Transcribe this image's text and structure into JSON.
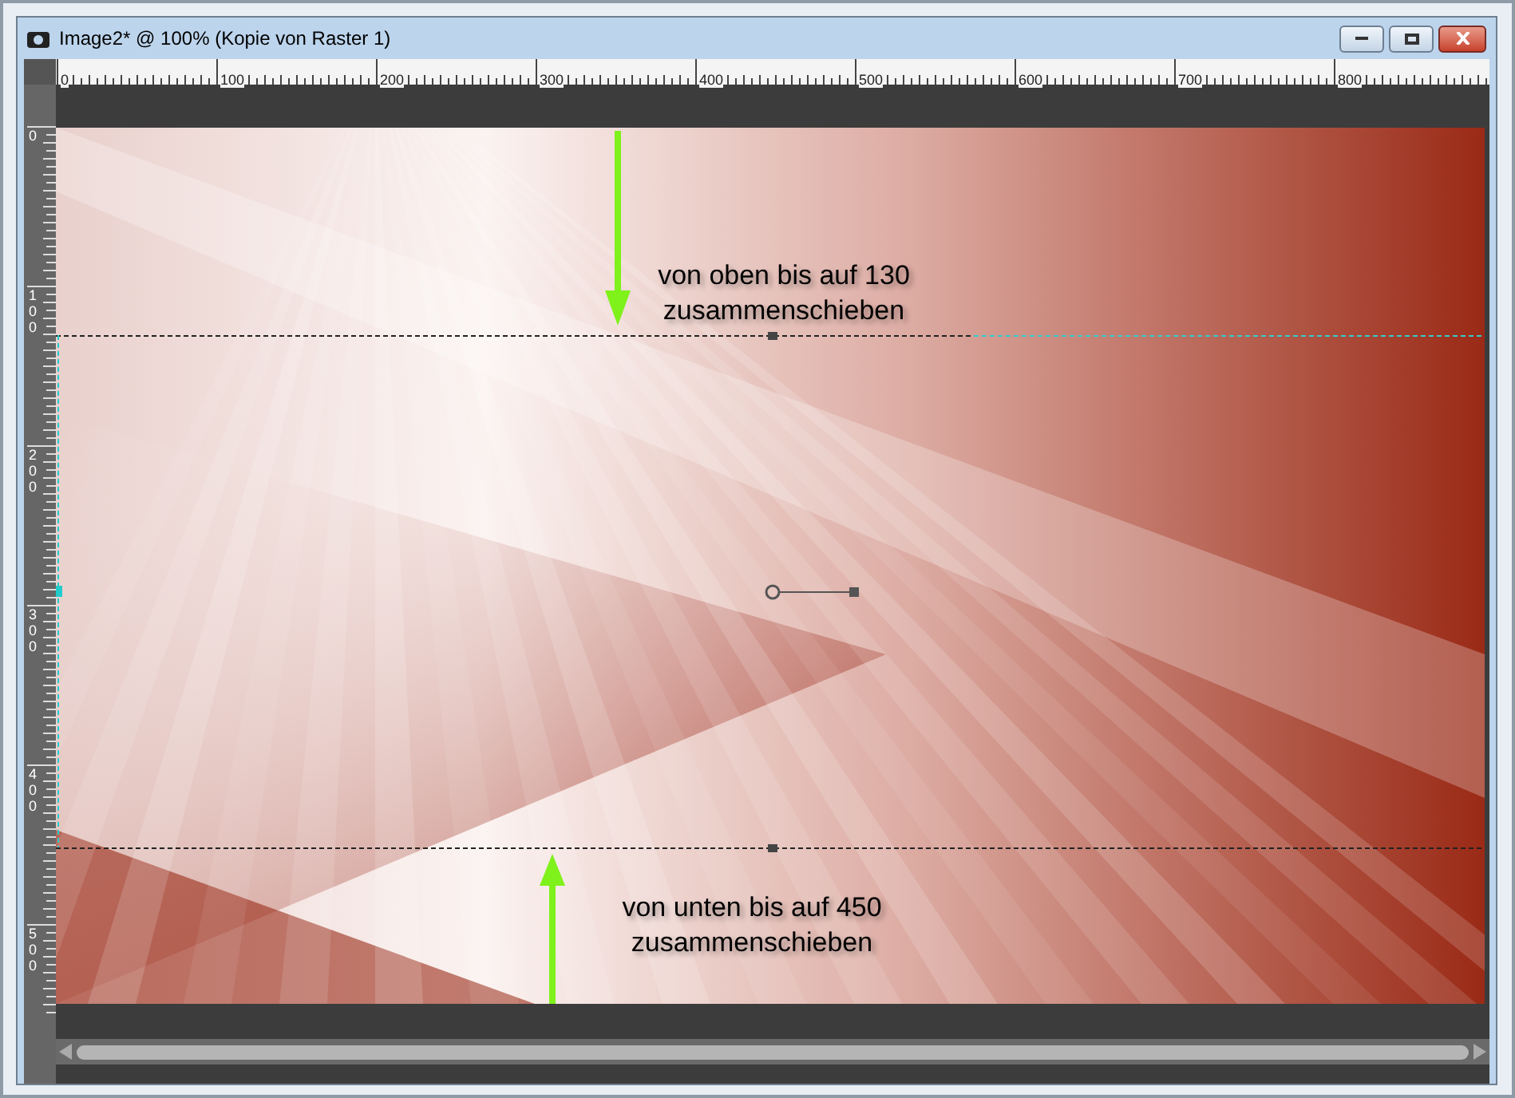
{
  "window": {
    "title": "Image2* @ 100% (Kopie von Raster 1)"
  },
  "ruler_top": {
    "labels": [
      "0",
      "100",
      "200",
      "300",
      "400",
      "500",
      "600",
      "700",
      "800"
    ]
  },
  "ruler_left": {
    "labels": [
      "0",
      "100",
      "200",
      "300",
      "400",
      "500"
    ]
  },
  "annotations": [
    {
      "kind": "down",
      "lines": [
        "von oben bis auf 130",
        "zusammenschieben"
      ]
    },
    {
      "kind": "up",
      "lines": [
        "von unten bis auf 450",
        "zusammenschieben"
      ]
    }
  ]
}
